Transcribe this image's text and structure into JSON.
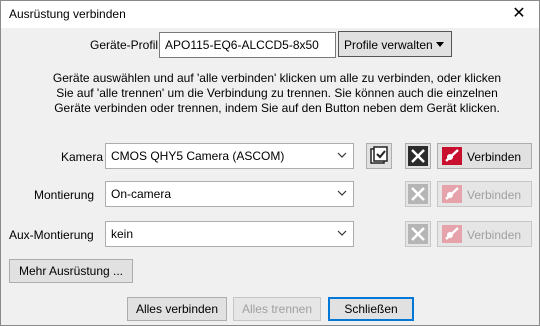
{
  "window": {
    "title": "Ausrüstung verbinden",
    "close_glyph": "✕"
  },
  "profile": {
    "label": "Geräte-Profil",
    "value": "APO115-EQ6-ALCCD5-8x50",
    "manage_label": "Profile verwalten"
  },
  "info_text": "Geräte auswählen und auf 'alle verbinden' klicken um alle zu verbinden, oder klicken Sie auf 'alle trennen' um die Verbindung zu trennen. Sie können auch die einzelnen Geräte verbinden oder trennen, indem Sie auf den Button neben dem Gerät klicken.",
  "devices": {
    "camera": {
      "label": "Kamera",
      "value": "CMOS QHY5 Camera (ASCOM)",
      "connect_label": "Verbinden"
    },
    "mount": {
      "label": "Montierung",
      "value": "On-camera",
      "connect_label": "Verbinden"
    },
    "aux_mount": {
      "label": "Aux-Montierung",
      "value": "kein",
      "connect_label": "Verbinden"
    }
  },
  "buttons": {
    "more_equipment": "Mehr Ausrüstung ...",
    "connect_all": "Alles verbinden",
    "disconnect_all": "Alles trennen",
    "close": "Schließen"
  },
  "colors": {
    "accent": "#0078d7",
    "disabled_text": "#a0a0a0",
    "plug_red": "#c8102e"
  }
}
